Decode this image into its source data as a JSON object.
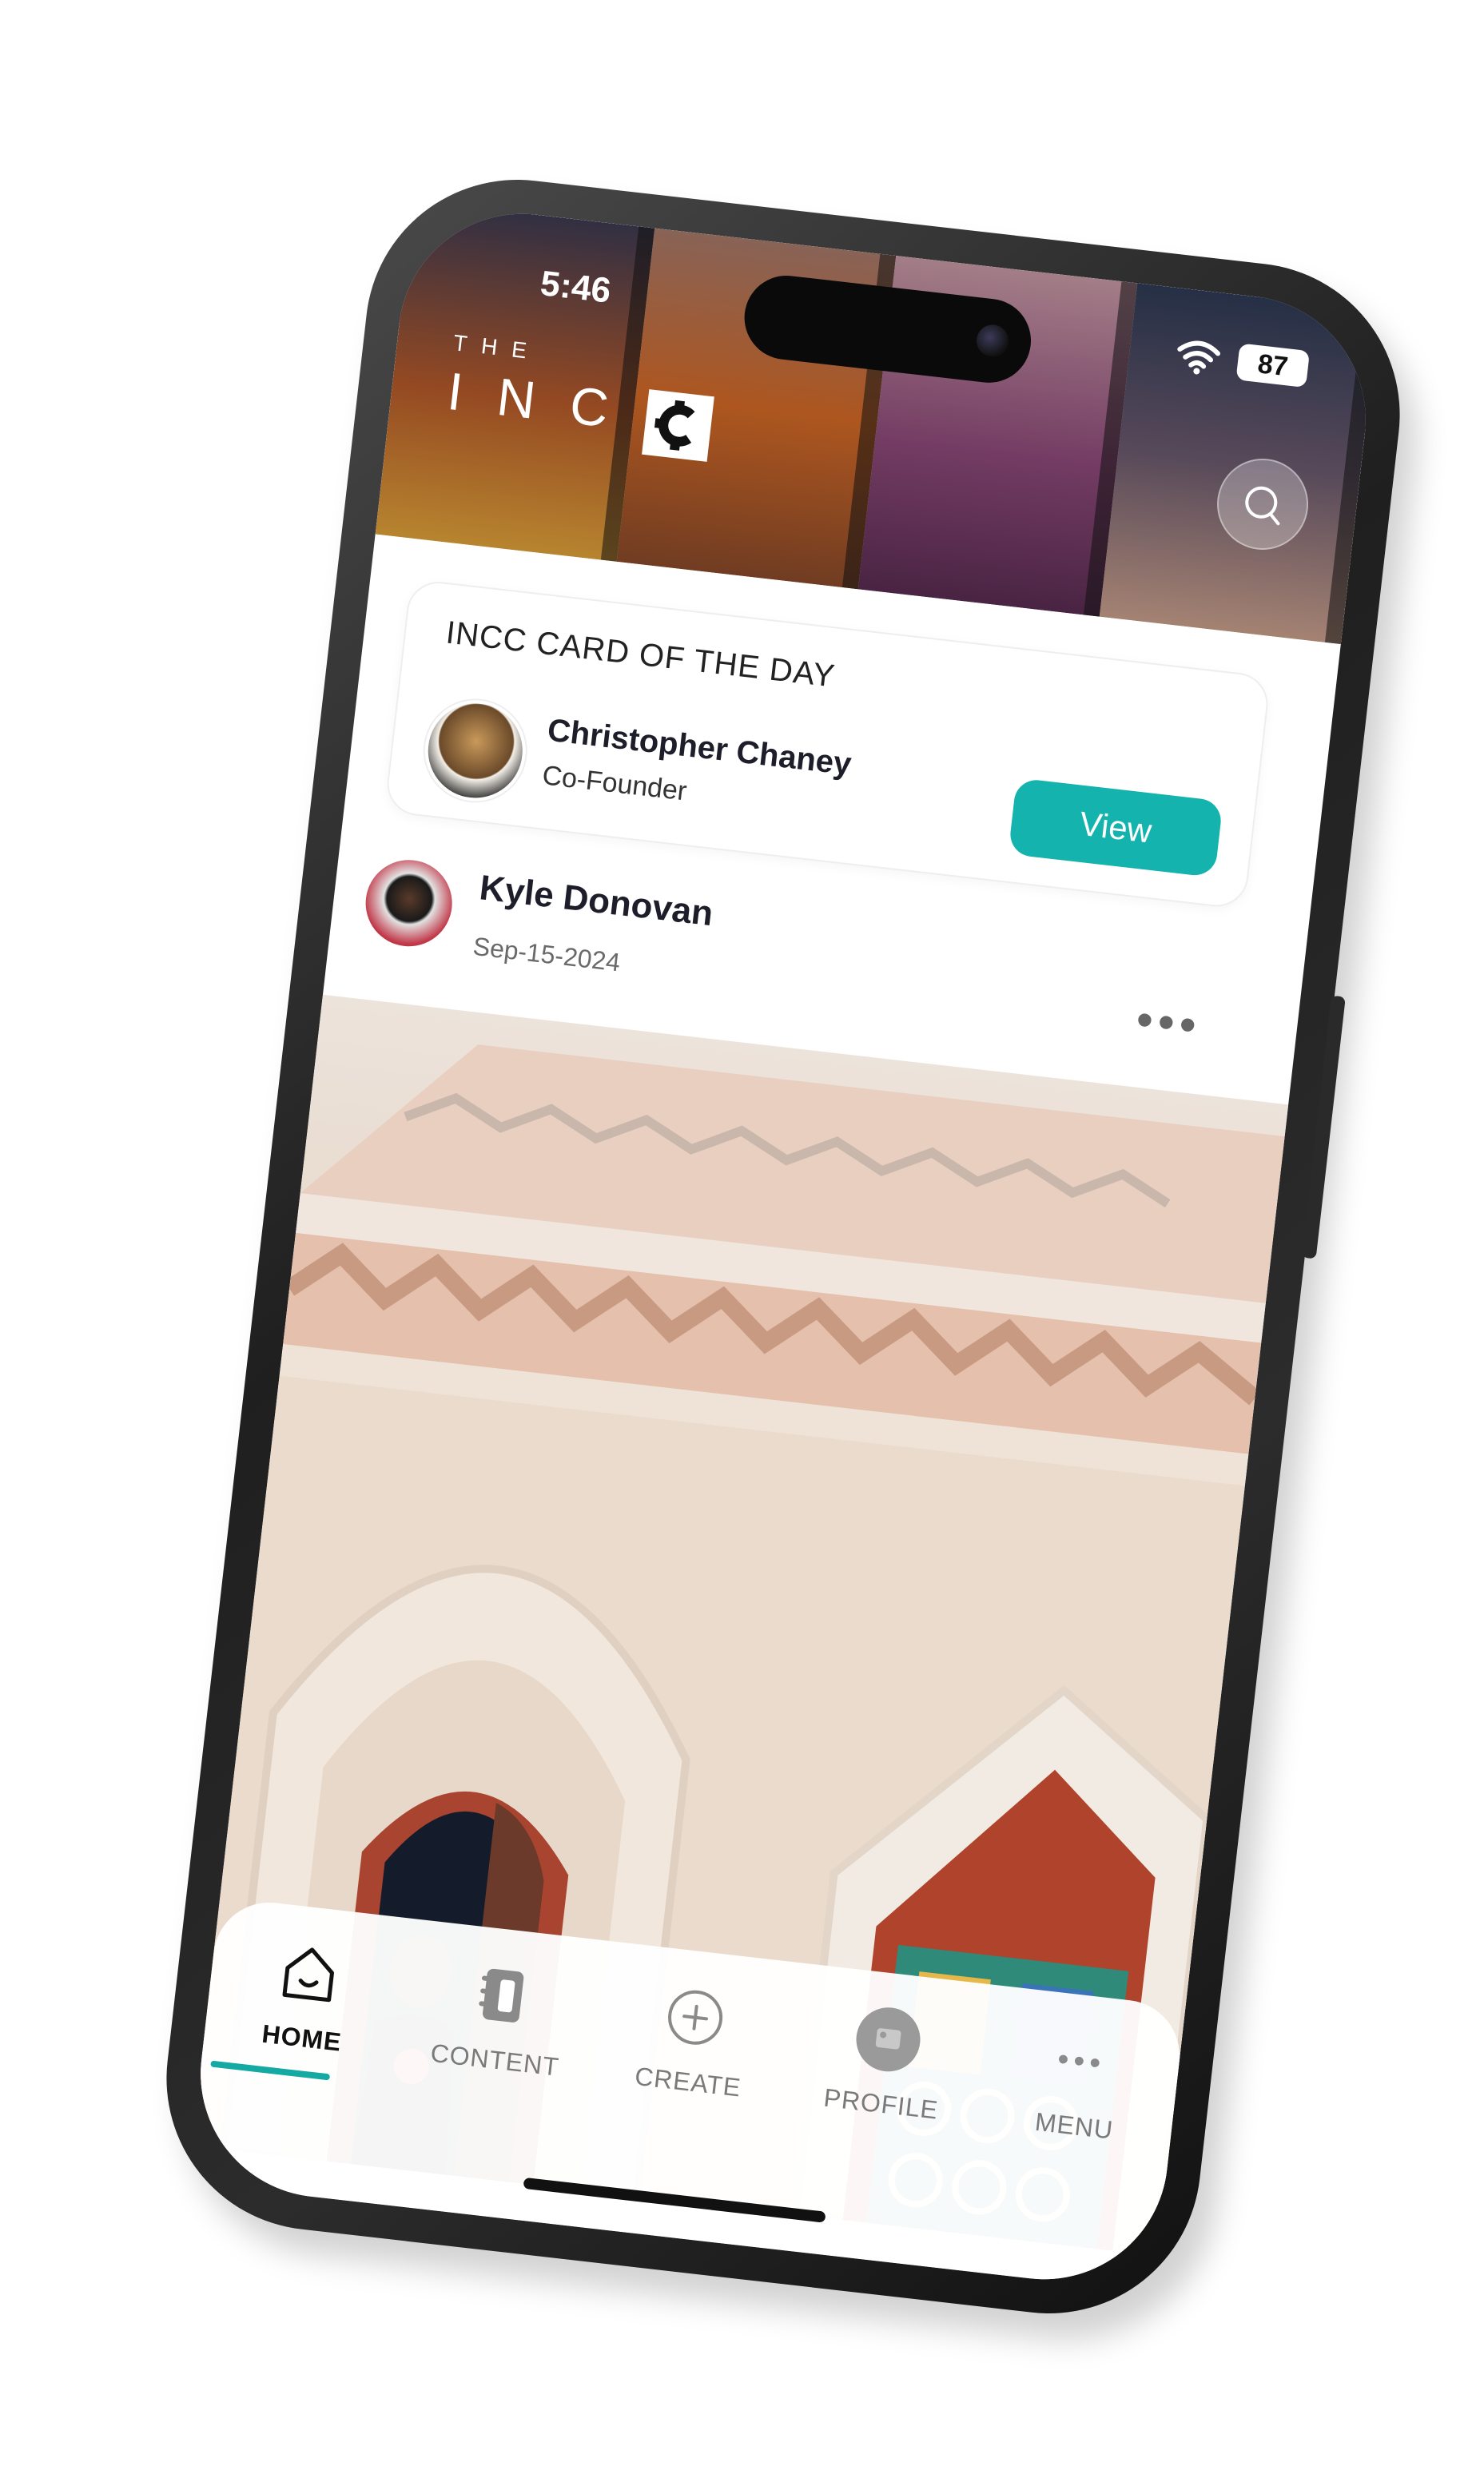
{
  "status": {
    "time": "5:46",
    "battery": "87"
  },
  "brand": {
    "the": "THE",
    "inc": "INC"
  },
  "card": {
    "title": "INCC CARD OF THE DAY",
    "name": "Christopher Chaney",
    "role": "Co-Founder",
    "button": "View"
  },
  "post": {
    "author": "Kyle Donovan",
    "date": "Sep-15-2024",
    "more": "•••"
  },
  "nav": {
    "home": "HOME",
    "content": "CONTENT",
    "create": "CREATE",
    "profile": "PROFILE",
    "menu": "MENU",
    "menu_dots": "•••"
  },
  "colors": {
    "accent": "#15b3ad",
    "text": "#1e1e2a"
  }
}
